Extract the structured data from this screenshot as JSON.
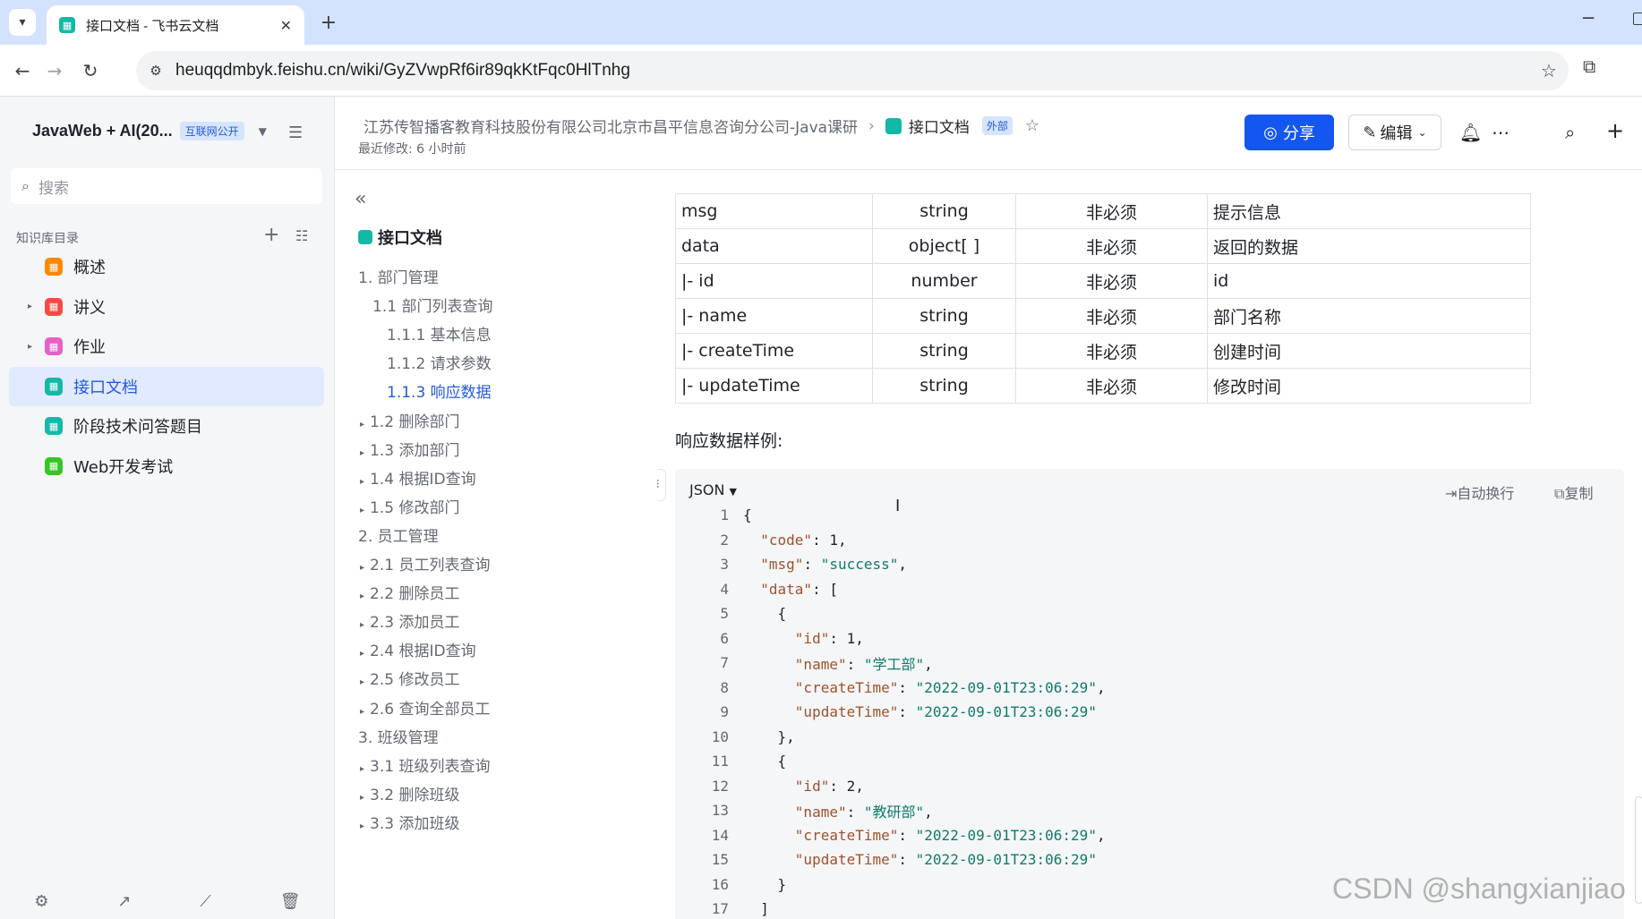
{
  "browser": {
    "tab_title": "接口文档 - 飞书云文档",
    "url": "heuqqdmbyk.feishu.cn/wiki/GyZVwpRf6ir89qkKtFqc0HlTnhg"
  },
  "sidebar": {
    "space_name": "JavaWeb + AI(20...",
    "space_badge": "互联网公开",
    "search_placeholder": "搜索",
    "kb_label": "知识库目录",
    "items": [
      {
        "label": "概述",
        "color": "#ff8800",
        "expandable": false
      },
      {
        "label": "讲义",
        "color": "#f54a45",
        "expandable": true
      },
      {
        "label": "作业",
        "color": "#e85fc7",
        "expandable": true
      },
      {
        "label": "接口文档",
        "color": "#14b8a6",
        "expandable": false,
        "active": true
      },
      {
        "label": "阶段技术问答题目",
        "color": "#14b8a6",
        "expandable": false
      },
      {
        "label": "Web开发考试",
        "color": "#34c724",
        "expandable": false
      }
    ]
  },
  "header": {
    "breadcrumb_parent": "江苏传智播客教育科技股份有限公司北京市昌平信息咨询分公司-Java课研",
    "breadcrumb_current": "接口文档",
    "external_badge": "外部",
    "last_modified": "最近修改: 6 小时前",
    "share_label": "分享",
    "edit_label": "编辑"
  },
  "toc": {
    "title": "接口文档",
    "items": [
      {
        "label": "1. 部门管理",
        "level": 0,
        "tri": false
      },
      {
        "label": "1.1 部门列表查询",
        "level": 1,
        "tri": false
      },
      {
        "label": "1.1.1 基本信息",
        "level": 2,
        "tri": false
      },
      {
        "label": "1.1.2 请求参数",
        "level": 2,
        "tri": false
      },
      {
        "label": "1.1.3 响应数据",
        "level": 2,
        "tri": false,
        "active": true
      },
      {
        "label": "1.2 删除部门",
        "level": 1,
        "tri": true
      },
      {
        "label": "1.3 添加部门",
        "level": 1,
        "tri": true
      },
      {
        "label": "1.4 根据ID查询",
        "level": 1,
        "tri": true
      },
      {
        "label": "1.5 修改部门",
        "level": 1,
        "tri": true
      },
      {
        "label": "2. 员工管理",
        "level": 0,
        "tri": false
      },
      {
        "label": "2.1 员工列表查询",
        "level": 1,
        "tri": true
      },
      {
        "label": "2.2 删除员工",
        "level": 1,
        "tri": true
      },
      {
        "label": "2.3 添加员工",
        "level": 1,
        "tri": true
      },
      {
        "label": "2.4 根据ID查询",
        "level": 1,
        "tri": true
      },
      {
        "label": "2.5 修改员工",
        "level": 1,
        "tri": true
      },
      {
        "label": "2.6 查询全部员工",
        "level": 1,
        "tri": true
      },
      {
        "label": "3. 班级管理",
        "level": 0,
        "tri": false
      },
      {
        "label": "3.1 班级列表查询",
        "level": 1,
        "tri": true
      },
      {
        "label": "3.2 删除班级",
        "level": 1,
        "tri": true
      },
      {
        "label": "3.3 添加班级",
        "level": 1,
        "tri": true
      }
    ]
  },
  "table": {
    "rows": [
      [
        "msg",
        "string",
        "非必须",
        "提示信息"
      ],
      [
        "data",
        "object[ ]",
        "非必须",
        "返回的数据"
      ],
      [
        "|- id",
        "number",
        "非必须",
        "id"
      ],
      [
        "|- name",
        "string",
        "非必须",
        "部门名称"
      ],
      [
        "|- createTime",
        "string",
        "非必须",
        "创建时间"
      ],
      [
        "|- updateTime",
        "string",
        "非必须",
        "修改时间"
      ]
    ]
  },
  "example": {
    "label": "响应数据样例:",
    "lang": "JSON",
    "wrap_label": "自动换行",
    "copy_label": "复制",
    "lines": [
      [
        {
          "t": "n",
          "v": "{"
        }
      ],
      [
        {
          "t": "n",
          "v": "  "
        },
        {
          "t": "k",
          "v": "\"code\""
        },
        {
          "t": "n",
          "v": ": 1,"
        }
      ],
      [
        {
          "t": "n",
          "v": "  "
        },
        {
          "t": "k",
          "v": "\"msg\""
        },
        {
          "t": "n",
          "v": ": "
        },
        {
          "t": "s",
          "v": "\"success\""
        },
        {
          "t": "n",
          "v": ","
        }
      ],
      [
        {
          "t": "n",
          "v": "  "
        },
        {
          "t": "k",
          "v": "\"data\""
        },
        {
          "t": "n",
          "v": ": ["
        }
      ],
      [
        {
          "t": "n",
          "v": "    {"
        }
      ],
      [
        {
          "t": "n",
          "v": "      "
        },
        {
          "t": "k",
          "v": "\"id\""
        },
        {
          "t": "n",
          "v": ": 1,"
        }
      ],
      [
        {
          "t": "n",
          "v": "      "
        },
        {
          "t": "k",
          "v": "\"name\""
        },
        {
          "t": "n",
          "v": ": "
        },
        {
          "t": "s",
          "v": "\"学工部\""
        },
        {
          "t": "n",
          "v": ","
        }
      ],
      [
        {
          "t": "n",
          "v": "      "
        },
        {
          "t": "k",
          "v": "\"createTime\""
        },
        {
          "t": "n",
          "v": ": "
        },
        {
          "t": "s",
          "v": "\"2022-09-01T23:06:29\""
        },
        {
          "t": "n",
          "v": ","
        }
      ],
      [
        {
          "t": "n",
          "v": "      "
        },
        {
          "t": "k",
          "v": "\"updateTime\""
        },
        {
          "t": "n",
          "v": ": "
        },
        {
          "t": "s",
          "v": "\"2022-09-01T23:06:29\""
        }
      ],
      [
        {
          "t": "n",
          "v": "    },"
        }
      ],
      [
        {
          "t": "n",
          "v": "    {"
        }
      ],
      [
        {
          "t": "n",
          "v": "      "
        },
        {
          "t": "k",
          "v": "\"id\""
        },
        {
          "t": "n",
          "v": ": 2,"
        }
      ],
      [
        {
          "t": "n",
          "v": "      "
        },
        {
          "t": "k",
          "v": "\"name\""
        },
        {
          "t": "n",
          "v": ": "
        },
        {
          "t": "s",
          "v": "\"教研部\""
        },
        {
          "t": "n",
          "v": ","
        }
      ],
      [
        {
          "t": "n",
          "v": "      "
        },
        {
          "t": "k",
          "v": "\"createTime\""
        },
        {
          "t": "n",
          "v": ": "
        },
        {
          "t": "s",
          "v": "\"2022-09-01T23:06:29\""
        },
        {
          "t": "n",
          "v": ","
        }
      ],
      [
        {
          "t": "n",
          "v": "      "
        },
        {
          "t": "k",
          "v": "\"updateTime\""
        },
        {
          "t": "n",
          "v": ": "
        },
        {
          "t": "s",
          "v": "\"2022-09-01T23:06:29\""
        }
      ],
      [
        {
          "t": "n",
          "v": "    }"
        }
      ],
      [
        {
          "t": "n",
          "v": "  ]"
        }
      ]
    ]
  },
  "watermark": "CSDN @shangxianjiao"
}
